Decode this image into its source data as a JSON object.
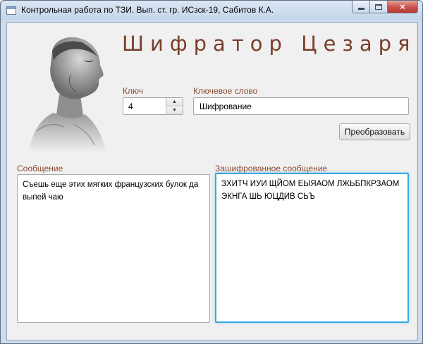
{
  "window": {
    "title": "Контрольная работа по ТЗИ. Вып. ст. гр. ИСзск-19, Сабитов К.А.",
    "close_glyph": "×"
  },
  "app": {
    "heading": "Шифратор Цезаря"
  },
  "key": {
    "label": "Ключ",
    "value": "4"
  },
  "keyword": {
    "label": "Ключевое слово",
    "value": "Шифрование"
  },
  "convert_button": "Преобразовать",
  "message": {
    "label": "Сообщение",
    "text": "Съешь еще этих мягких французских булок да выпей чаю"
  },
  "encrypted": {
    "label": "Зашифрованное сообщение",
    "text": "ЗХИТЧ ИУИ ЩЙОМ ЕЫЯАОМ ЛЖЬБПКРЗАОМ ЭКНГА ШЬ ЮЦДИВ СЬЪ"
  },
  "icons": {
    "app": "window-app-icon",
    "minimize": "minimize-icon",
    "maximize": "maximize-icon",
    "close": "close-icon",
    "spin_up": "arrow-up-icon",
    "spin_down": "arrow-down-icon",
    "portrait": "caesar-bust-image"
  },
  "colors": {
    "heading": "#7a3f2a",
    "label": "#8a4a33",
    "focus": "#3aa8e0",
    "close_button": "#c75050"
  }
}
